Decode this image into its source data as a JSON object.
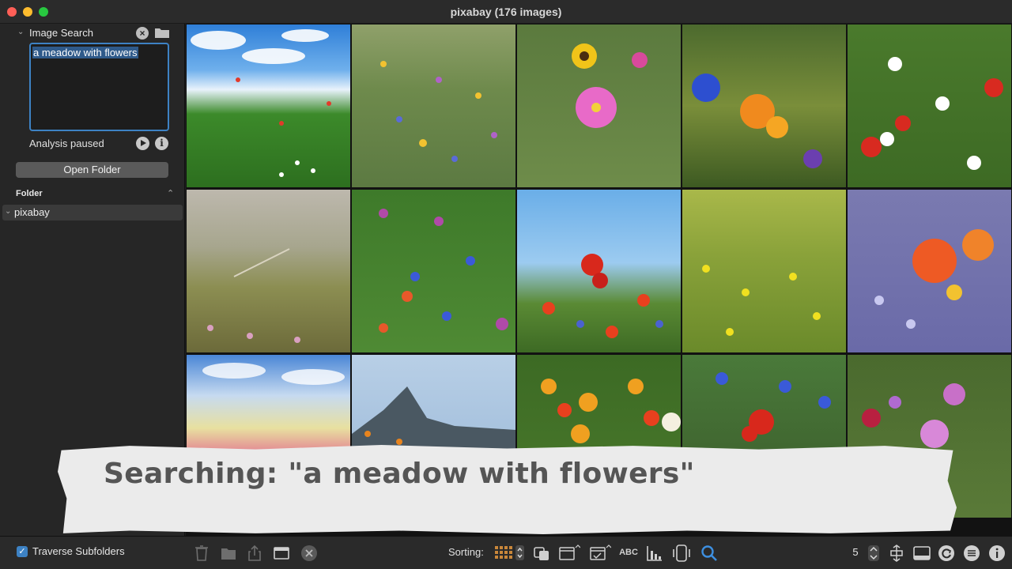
{
  "window": {
    "title": "pixabay (176 images)"
  },
  "sidebar": {
    "search_section_label": "Image Search",
    "query_value": "a meadow with flowers",
    "status_text": "Analysis paused",
    "open_folder_label": "Open Folder",
    "folder_section_label": "Folder",
    "folders": [
      {
        "name": "pixabay"
      }
    ]
  },
  "banner": {
    "text": "Searching: \"a meadow with flowers\""
  },
  "bottombar": {
    "traverse_label": "Traverse Subfolders",
    "traverse_checked": true,
    "sorting_label": "Sorting:",
    "sort_abc_label": "ABC",
    "columns_value": "5"
  },
  "colors": {
    "accent": "#3d82c4",
    "search_active": "#3d8fe0"
  }
}
